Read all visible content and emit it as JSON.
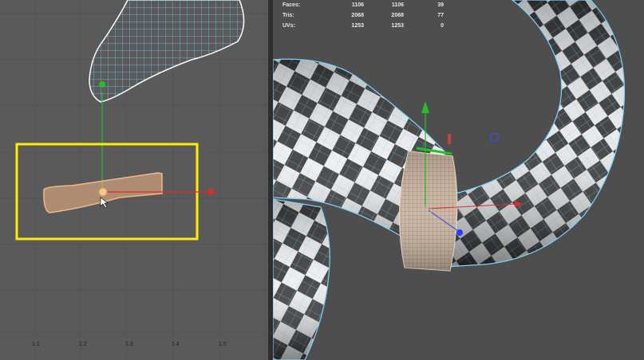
{
  "uv_editor": {
    "ruler_labels": [
      "1.1",
      "1.2",
      "1.3",
      "1.4",
      "1.5"
    ]
  },
  "viewport": {
    "stats": [
      {
        "label": "Faces:",
        "v1": "1106",
        "v2": "1106",
        "v3": "39"
      },
      {
        "label": "Tris:",
        "v1": "2068",
        "v2": "2068",
        "v3": "77"
      },
      {
        "label": "UVs:",
        "v1": "1253",
        "v2": "1253",
        "v3": "0"
      }
    ]
  },
  "colors": {
    "uv_background": "#5a5a5a",
    "viewport_background": "#4e4e4e",
    "wireframe": "#7fd4ff",
    "highlight_box": "#ffee00",
    "selection": "#f2b888",
    "axis_x": "#e22a2a",
    "axis_y": "#22c02a",
    "axis_z": "#2a3cff"
  },
  "icons": [
    "move-manipulator-icon",
    "cursor-arrow-icon"
  ]
}
